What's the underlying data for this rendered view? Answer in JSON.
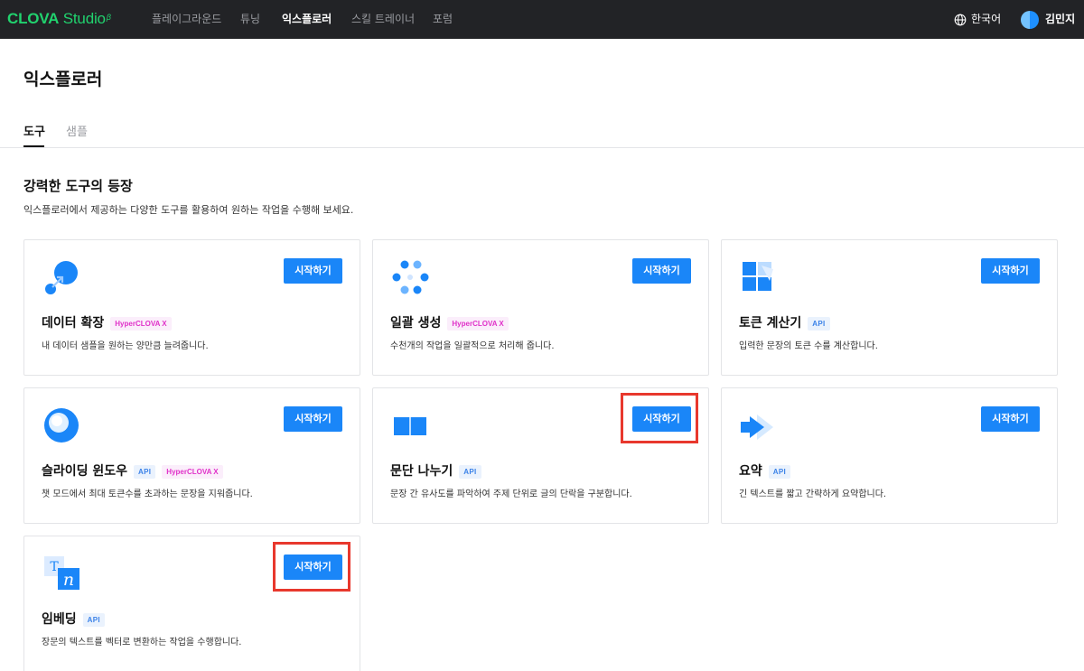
{
  "brand": {
    "name_bold": "CLOVA",
    "name_light": " Studio",
    "sup": "β"
  },
  "nav": {
    "items": [
      "플레이그라운드",
      "튜닝",
      "익스플로러",
      "스킬 트레이너",
      "포럼"
    ],
    "active_index": 2
  },
  "header_right": {
    "language": "한국어",
    "user_name": "김민지"
  },
  "page": {
    "title": "익스플로러",
    "tabs": [
      "도구",
      "샘플"
    ],
    "active_tab": 0
  },
  "section": {
    "title": "강력한 도구의 등장",
    "description": "익스플로러에서 제공하는 다양한 도구를 활용하여 원하는 작업을 수행해 보세요."
  },
  "start_label": "시작하기",
  "cards": [
    {
      "title": "데이터 확장",
      "badges": [
        "HyperCLOVA X"
      ],
      "description": "내 데이터 샘플을 원하는 양만큼 늘려줍니다.",
      "icon": "data-expand-icon"
    },
    {
      "title": "일괄 생성",
      "badges": [
        "HyperCLOVA X"
      ],
      "description": "수천개의 작업을 일괄적으로 처리해 줍니다.",
      "icon": "batch-generate-icon"
    },
    {
      "title": "토큰 계산기",
      "badges": [
        "API"
      ],
      "description": "입력한 문장의 토큰 수를 계산합니다.",
      "icon": "token-calculator-icon"
    },
    {
      "title": "슬라이딩 윈도우",
      "badges": [
        "API",
        "HyperCLOVA X"
      ],
      "description": "챗 모드에서 최대 토큰수를 초과하는 문장을 지워줍니다.",
      "icon": "sliding-window-icon"
    },
    {
      "title": "문단 나누기",
      "badges": [
        "API"
      ],
      "description": "문장 간 유사도를 파악하여 주제 단위로 글의 단락을 구분합니다.",
      "icon": "paragraph-split-icon"
    },
    {
      "title": "요약",
      "badges": [
        "API"
      ],
      "description": "긴 텍스트를 짧고 간략하게 요약합니다.",
      "icon": "summary-icon"
    },
    {
      "title": "임베딩",
      "badges": [
        "API"
      ],
      "description": "장문의 텍스트를 벡터로 변환하는 작업을 수행합니다.",
      "icon": "embedding-icon"
    }
  ],
  "colors": {
    "nav_bg": "#222326",
    "brand_green": "#21d26e",
    "primary_blue": "#1a86f8",
    "highlight_red": "#e8382d"
  }
}
